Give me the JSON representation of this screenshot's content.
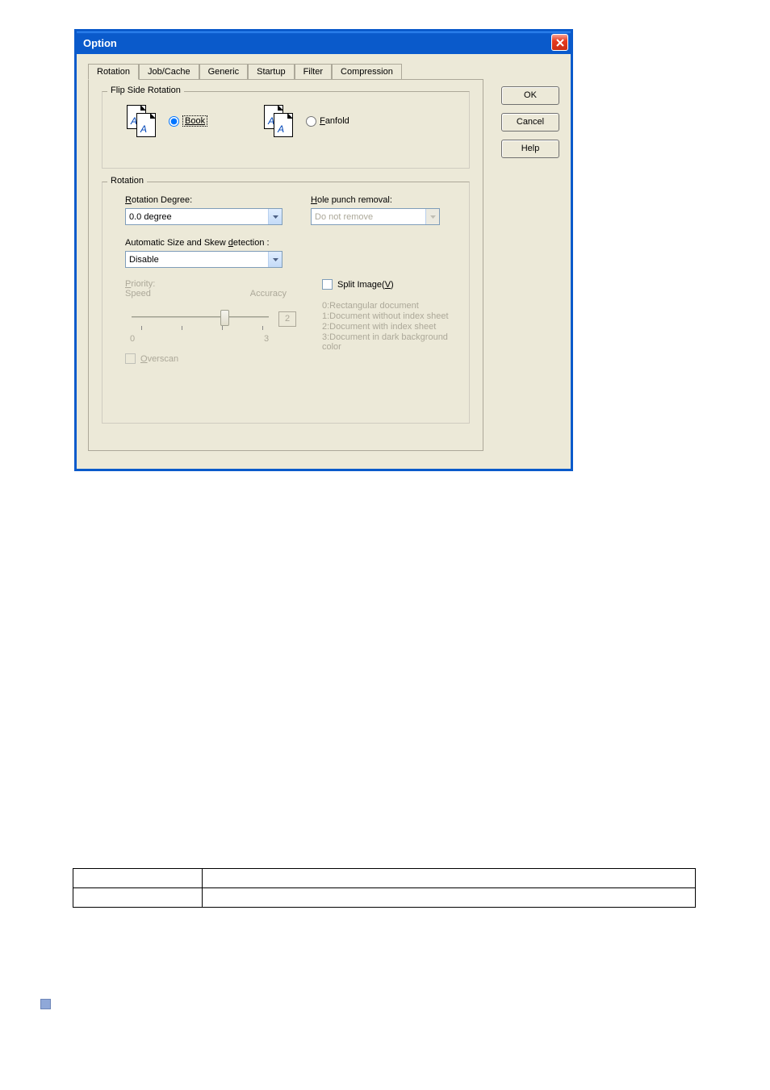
{
  "window": {
    "title": "Option"
  },
  "tabs": [
    "Rotation",
    "Job/Cache",
    "Generic",
    "Startup",
    "Filter",
    "Compression"
  ],
  "buttons": {
    "ok": "OK",
    "cancel": "Cancel",
    "help": "Help"
  },
  "flip": {
    "group_title": "Flip Side Rotation",
    "book": "Book",
    "fanfold": "Fanfold"
  },
  "rotation": {
    "group_title": "Rotation",
    "degree_label_pre": "R",
    "degree_label_post": "otation Degree:",
    "degree_value": "0.0 degree",
    "hole_label_pre": "H",
    "hole_label_post": "ole punch removal:",
    "hole_value": "Do not remove",
    "auto_label_pre": "Automatic Size and Skew ",
    "auto_u": "d",
    "auto_label_post": "etection :",
    "auto_value": "Disable",
    "priority_label_pre": "P",
    "priority_label_post": "riority:",
    "speed": "Speed",
    "accuracy": "Accuracy",
    "slider_value": "2",
    "slider_min": "0",
    "slider_max": "3",
    "overscan_pre": "O",
    "overscan_post": "verscan",
    "split_label": "Split Image(V)",
    "split_opts": [
      "0:Rectangular document",
      "1:Document without index sheet",
      "2:Document with index sheet",
      "3:Document in dark background color"
    ]
  }
}
